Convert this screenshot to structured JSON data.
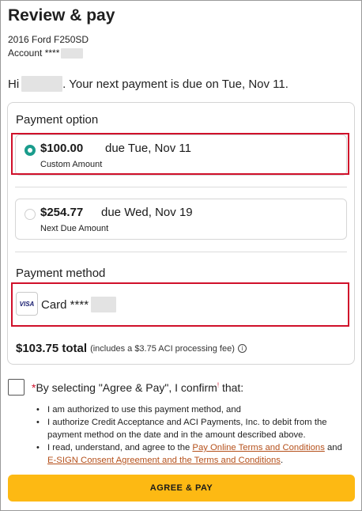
{
  "header": {
    "title": "Review & pay",
    "vehicle": "2016 Ford F250SD",
    "account_label": "Account ****"
  },
  "greeting": {
    "prefix": "Hi",
    "message": ". Your next payment is due on Tue, Nov 11."
  },
  "payment_option": {
    "label": "Payment option",
    "options": [
      {
        "amount": "$100.00",
        "due": "due Tue, Nov 11",
        "sub": "Custom Amount",
        "selected": true
      },
      {
        "amount": "$254.77",
        "due": "due Wed, Nov 19",
        "sub": "Next Due Amount",
        "selected": false
      }
    ]
  },
  "payment_method": {
    "label": "Payment method",
    "card_brand": "VISA",
    "card_text": "Card ****"
  },
  "total": {
    "amount": "$103.75 total",
    "fee_note": "(includes a $3.75 ACI processing fee)",
    "info_icon": "info-icon"
  },
  "confirm": {
    "asterisk": "*",
    "text_before": "By selecting \"Agree & Pay\", I confirm",
    "mark": "!",
    "text_after": " that:"
  },
  "terms": {
    "items": [
      "I am authorized to use this payment method, and",
      "I authorize Credit Acceptance and ACI Payments, Inc. to debit from the payment method on the date and in the amount described above."
    ],
    "item3_prefix": "I read, understand, and agree to the ",
    "item3_link1": "Pay Online Terms and Conditions",
    "item3_middle": " and ",
    "item3_link2": "E-SIGN Consent Agreement and the Terms and Conditions",
    "item3_suffix": "."
  },
  "actions": {
    "agree_pay_label": "AGREE & PAY"
  },
  "colors": {
    "accent_radio": "#1a9c8c",
    "button_yellow": "#fdb913",
    "highlight_red": "#d0102a",
    "link_orange": "#b5501b"
  }
}
